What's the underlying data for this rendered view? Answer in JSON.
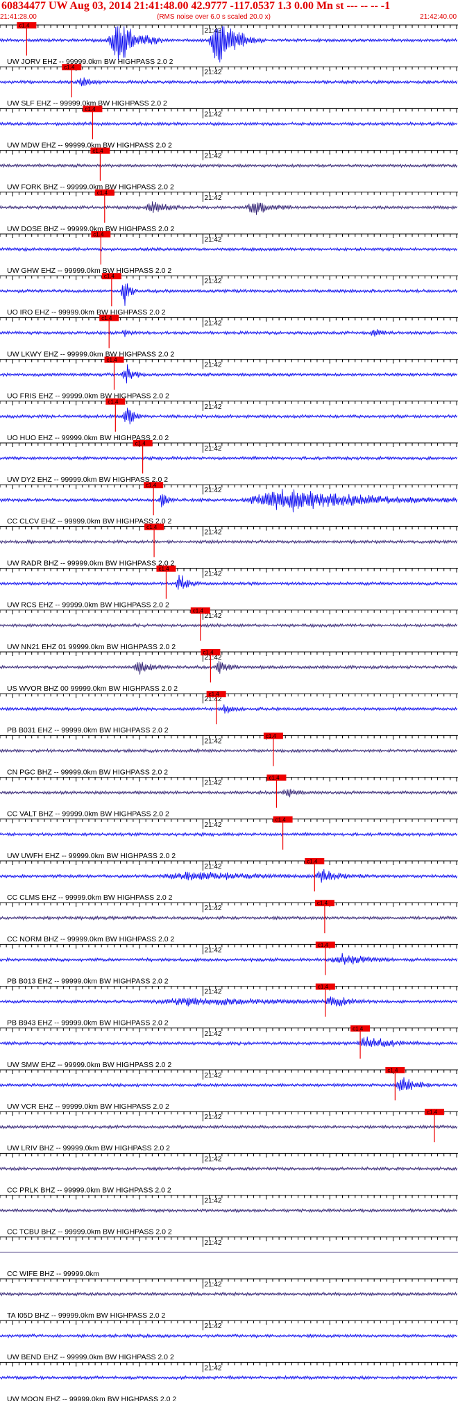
{
  "header": {
    "title": "60834477 UW Aug 03, 2014 21:41:48.00   42.9777 -117.0537  1.3 0.00 Mn st --- -- --  -1",
    "start_time": "21:41:28.00",
    "subtitle": "(RMS noise over 6.0 s scaled 20.0 x)",
    "end_time": "21:42:40.00"
  },
  "colors": {
    "text_red": "#e00000",
    "trace_blue": "#0000ee",
    "trace_navy": "#2a1a6e",
    "pick_red": "#ee0000",
    "axis": "#000000"
  },
  "chart_data": {
    "type": "line",
    "title": "60834477 UW Aug 03, 2014 21:41:48.00   42.9777 -117.0537  1.3 0.00 Mn st --- -- --  -1",
    "x_start": "21:41:28.00",
    "x_end": "21:42:40.00",
    "time_marker_label": "21:42",
    "pick_label": "c1.4",
    "traces": [
      {
        "label": "UW JORV EHZ -- 99999.0km BW  HIGHPASS  2.0  2",
        "color": "blue",
        "pick_sec": 4.2,
        "events": [
          {
            "t": 18.5,
            "amp": 8,
            "dur": 7
          },
          {
            "t": 34.5,
            "amp": 8,
            "dur": 7
          }
        ]
      },
      {
        "label": "UW SLF EHZ -- 99999.0km BW  HIGHPASS  2.0  2",
        "color": "blue",
        "pick_sec": 11.3,
        "events": [
          {
            "t": 13,
            "amp": 1.4,
            "dur": 4
          }
        ]
      },
      {
        "label": "UW MDW EHZ -- 99999.0km BW  HIGHPASS  2.0  2",
        "color": "blue",
        "pick_sec": 14.6,
        "events": []
      },
      {
        "label": "UW FORK BHZ -- 99999.0km BW  HIGHPASS  2.0  2",
        "color": "navy",
        "pick_sec": 15.8,
        "events": []
      },
      {
        "label": "UW DOSE BHZ -- 99999.0km BW  HIGHPASS  2.0  2",
        "color": "navy",
        "pick_sec": 16.5,
        "events": [
          {
            "t": 24,
            "amp": 2.2,
            "dur": 5
          },
          {
            "t": 40,
            "amp": 2.4,
            "dur": 6
          }
        ]
      },
      {
        "label": "UW GHW EHZ -- 99999.0km BW  HIGHPASS  2.0  2",
        "color": "blue",
        "pick_sec": 15.9,
        "events": []
      },
      {
        "label": "UO IRO EHZ -- 99999.0km BW  HIGHPASS  2.0  2",
        "color": "blue",
        "pick_sec": 17.6,
        "events": [
          {
            "t": 19.5,
            "amp": 6,
            "dur": 2
          }
        ]
      },
      {
        "label": "UW LKWY EHZ -- 99999.0km BW  HIGHPASS  2.0  2",
        "color": "blue",
        "pick_sec": 17.2,
        "events": [
          {
            "t": 19.5,
            "amp": 1.5,
            "dur": 2
          },
          {
            "t": 59,
            "amp": 1.4,
            "dur": 3
          }
        ]
      },
      {
        "label": "UO FRIS EHZ -- 99999.0km BW  HIGHPASS  2.0  2",
        "color": "blue",
        "pick_sec": 18.0,
        "events": [
          {
            "t": 19.8,
            "amp": 4,
            "dur": 2.5
          }
        ]
      },
      {
        "label": "UO HUO EHZ -- 99999.0km BW  HIGHPASS  2.0  2",
        "color": "blue",
        "pick_sec": 18.2,
        "events": [
          {
            "t": 20,
            "amp": 5,
            "dur": 2.5
          }
        ]
      },
      {
        "label": "UW DY2 EHZ -- 99999.0km BW  HIGHPASS  2.0  2",
        "color": "blue",
        "pick_sec": 22.5,
        "events": []
      },
      {
        "label": "CC CLCV EHZ -- 99999.0km BW  HIGHPASS  2.0  2",
        "color": "blue",
        "pick_sec": 24.2,
        "events": [
          {
            "t": 25.5,
            "amp": 3,
            "dur": 2
          },
          {
            "t": 45,
            "amp": 4,
            "dur": 28
          }
        ]
      },
      {
        "label": "UW RADR BHZ -- 99999.0km BW  HIGHPASS  2.0  2",
        "color": "navy",
        "pick_sec": 24.3,
        "events": []
      },
      {
        "label": "UW RCS EHZ -- 99999.0km BW  HIGHPASS  2.0  2",
        "color": "blue",
        "pick_sec": 26.2,
        "events": [
          {
            "t": 28.3,
            "amp": 3,
            "dur": 3
          }
        ]
      },
      {
        "label": "UW NN21 EHZ 01 99999.0km BW  HIGHPASS  2.0  2",
        "color": "navy",
        "pick_sec": 31.6,
        "events": []
      },
      {
        "label": "US WVOR BHZ 00 99999.0km BW  HIGHPASS  2.0  2",
        "color": "navy",
        "pick_sec": 33.2,
        "events": [
          {
            "t": 22,
            "amp": 2.2,
            "dur": 5
          },
          {
            "t": 34.6,
            "amp": 2.5,
            "dur": 3
          }
        ]
      },
      {
        "label": "PB B031 EHZ -- 99999.0km BW  HIGHPASS  2.0  2",
        "color": "blue",
        "pick_sec": 34.1,
        "events": [
          {
            "t": 35.5,
            "amp": 1.8,
            "dur": 3
          }
        ]
      },
      {
        "label": "CN PGC BHZ -- 99999.0km BW  HIGHPASS  2.0  2",
        "color": "navy",
        "pick_sec": 43.1,
        "events": []
      },
      {
        "label": "CC VALT BHZ -- 99999.0km BW  HIGHPASS  2.0  2",
        "color": "navy",
        "pick_sec": 43.6,
        "events": [
          {
            "t": 45.2,
            "amp": 2,
            "dur": 3
          }
        ]
      },
      {
        "label": "UW UWFH EHZ -- 99999.0km BW  HIGHPASS  2.0  2",
        "color": "blue",
        "pick_sec": 44.6,
        "events": []
      },
      {
        "label": "CC CLMS EHZ -- 99999.0km BW  HIGHPASS  2.0  2",
        "color": "blue",
        "pick_sec": 49.6,
        "events": [
          {
            "t": 51,
            "amp": 2.2,
            "dur": 6
          },
          {
            "t": 30,
            "amp": 1.4,
            "dur": 20
          }
        ]
      },
      {
        "label": "CC NORM BHZ -- 99999.0km BW  HIGHPASS  2.0  2",
        "color": "navy",
        "pick_sec": 51.2,
        "events": []
      },
      {
        "label": "PB B013 EHZ -- 99999.0km BW  HIGHPASS  2.0  2",
        "color": "blue",
        "pick_sec": 51.3,
        "events": [
          {
            "t": 54,
            "amp": 2,
            "dur": 8
          }
        ]
      },
      {
        "label": "PB B943 EHZ -- 99999.0km BW  HIGHPASS  2.0  2",
        "color": "blue",
        "pick_sec": 51.3,
        "events": [
          {
            "t": 52.5,
            "amp": 2.5,
            "dur": 5
          },
          {
            "t": 30,
            "amp": 1.3,
            "dur": 25
          }
        ]
      },
      {
        "label": "UW SMW EHZ -- 99999.0km BW  HIGHPASS  2.0  2",
        "color": "blue",
        "pick_sec": 56.8,
        "events": [
          {
            "t": 58,
            "amp": 2.2,
            "dur": 8
          }
        ]
      },
      {
        "label": "UW VCR EHZ -- 99999.0km BW  HIGHPASS  2.0  2",
        "color": "blue",
        "pick_sec": 62.3,
        "events": [
          {
            "t": 63.5,
            "amp": 3,
            "dur": 5
          }
        ]
      },
      {
        "label": "UW LRIV BHZ -- 99999.0km BW  HIGHPASS  2.0  2",
        "color": "navy",
        "pick_sec": 68.5,
        "events": []
      },
      {
        "label": "CC PRLK BHZ -- 99999.0km BW  HIGHPASS  2.0  2",
        "color": "navy",
        "pick_sec": null,
        "events": []
      },
      {
        "label": "CC TCBU BHZ -- 99999.0km BW  HIGHPASS  2.0  2",
        "color": "navy",
        "pick_sec": null,
        "events": []
      },
      {
        "label": "CC WIFE BHZ -- 99999.0km",
        "color": "navy",
        "pick_sec": null,
        "events": [],
        "flat": true
      },
      {
        "label": "TA I05D BHZ -- 99999.0km BW  HIGHPASS  2.0  2",
        "color": "navy",
        "pick_sec": null,
        "events": []
      },
      {
        "label": "UW BEND EHZ -- 99999.0km BW  HIGHPASS  2.0  2",
        "color": "blue",
        "pick_sec": null,
        "events": []
      },
      {
        "label": "UW MOON EHZ -- 99999.0km BW  HIGHPASS  2.0  2",
        "color": "blue",
        "pick_sec": null,
        "events": []
      }
    ]
  }
}
